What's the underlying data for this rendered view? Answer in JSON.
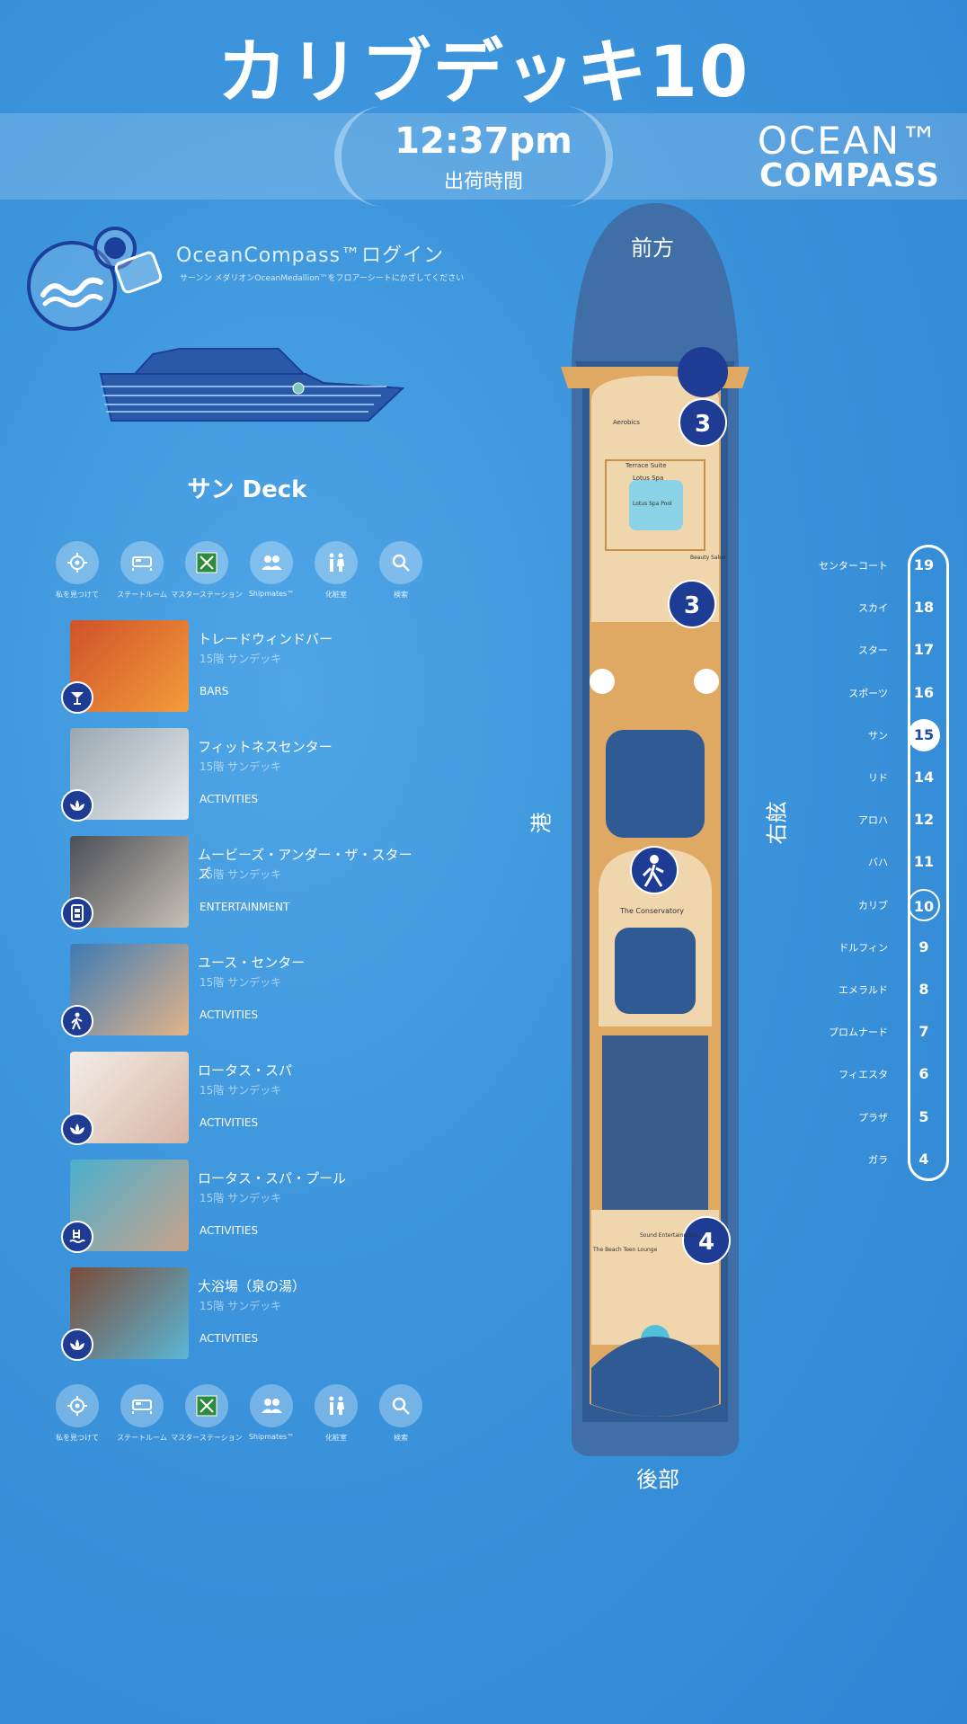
{
  "header": {
    "title": "カリブデッキ10",
    "time": "12:37pm",
    "time_label": "出荷時間",
    "logo_line1": "OCEAN™",
    "logo_line2": "COMPASS"
  },
  "login": {
    "title": "OceanCompass™ログイン",
    "subtitle": "サーンン メダリオンOceanMedallion™をフロアーシートにかざしてください"
  },
  "current_deck_label": "サン Deck",
  "toolbar": [
    {
      "icon": "locate-icon",
      "label": "私を見つけて"
    },
    {
      "icon": "bed-icon",
      "label": "ステートルーム"
    },
    {
      "icon": "muster-icon",
      "label": "マスターステーション"
    },
    {
      "icon": "shipmates-icon",
      "label": "Shipmates™"
    },
    {
      "icon": "restroom-icon",
      "label": "化粧室"
    },
    {
      "icon": "search-icon",
      "label": "検索"
    }
  ],
  "venues": [
    {
      "name": "トレードウィンドバー",
      "location": "15階 サンデッキ",
      "category": "BARS",
      "icon": "cocktail-icon",
      "thumb": [
        "#d0522a",
        "#f39c3a"
      ]
    },
    {
      "name": "フィットネスセンター",
      "location": "15階 サンデッキ",
      "category": "ACTIVITIES",
      "icon": "lotus-icon",
      "thumb": [
        "#9aa7b2",
        "#e8ecef"
      ]
    },
    {
      "name": "ムービーズ・アンダー・ザ・スターズ",
      "location": "15階 サンデッキ",
      "category": "ENTERTAINMENT",
      "icon": "ticket-icon",
      "thumb": [
        "#4c4f57",
        "#c7c1b6"
      ]
    },
    {
      "name": "ユース・センター",
      "location": "15階 サンデッキ",
      "category": "ACTIVITIES",
      "icon": "walker-icon",
      "thumb": [
        "#3d7bb5",
        "#e3b489"
      ]
    },
    {
      "name": "ロータス・スパ",
      "location": "15階 サンデッキ",
      "category": "ACTIVITIES",
      "icon": "lotus-icon",
      "thumb": [
        "#f2ede8",
        "#d7b6a5"
      ]
    },
    {
      "name": "ロータス・スパ・プール",
      "location": "15階 サンデッキ",
      "category": "ACTIVITIES",
      "icon": "pool-icon",
      "thumb": [
        "#4ab0cf",
        "#c9a28a"
      ]
    },
    {
      "name": "大浴場（泉の湯）",
      "location": "15階 サンデッキ",
      "category": "ACTIVITIES",
      "icon": "lotus-icon",
      "thumb": [
        "#7a4b3a",
        "#5bb7d6"
      ]
    }
  ],
  "directions": {
    "fore": "前方",
    "aft": "後部",
    "port": "港",
    "starboard": "右舷"
  },
  "map": {
    "markers": [
      "3",
      "3",
      "4"
    ],
    "labels": [
      "Aerobics",
      "Terrace Suite",
      "Lotus Spa",
      "Lotus Spa Pool",
      "Beauty Salon",
      "The Conservatory",
      "Sound Entertainment",
      "The Beach Teen Lounge"
    ]
  },
  "decks": [
    {
      "name": "センターコート",
      "num": "19"
    },
    {
      "name": "スカイ",
      "num": "18"
    },
    {
      "name": "スター",
      "num": "17"
    },
    {
      "name": "スポーツ",
      "num": "16"
    },
    {
      "name": "サン",
      "num": "15",
      "state": "active"
    },
    {
      "name": "リド",
      "num": "14"
    },
    {
      "name": "アロハ",
      "num": "12"
    },
    {
      "name": "バハ",
      "num": "11"
    },
    {
      "name": "カリブ",
      "num": "10",
      "state": "here"
    },
    {
      "name": "ドルフィン",
      "num": "9"
    },
    {
      "name": "エメラルド",
      "num": "8"
    },
    {
      "name": "プロムナード",
      "num": "7"
    },
    {
      "name": "フィエスタ",
      "num": "6"
    },
    {
      "name": "プラザ",
      "num": "5"
    },
    {
      "name": "ガラ",
      "num": "4"
    }
  ],
  "colors": {
    "accent": "#1e3c93",
    "deck_wood": "#e0a963",
    "hull": "#3f6fa6",
    "background": "#3c95dc"
  }
}
